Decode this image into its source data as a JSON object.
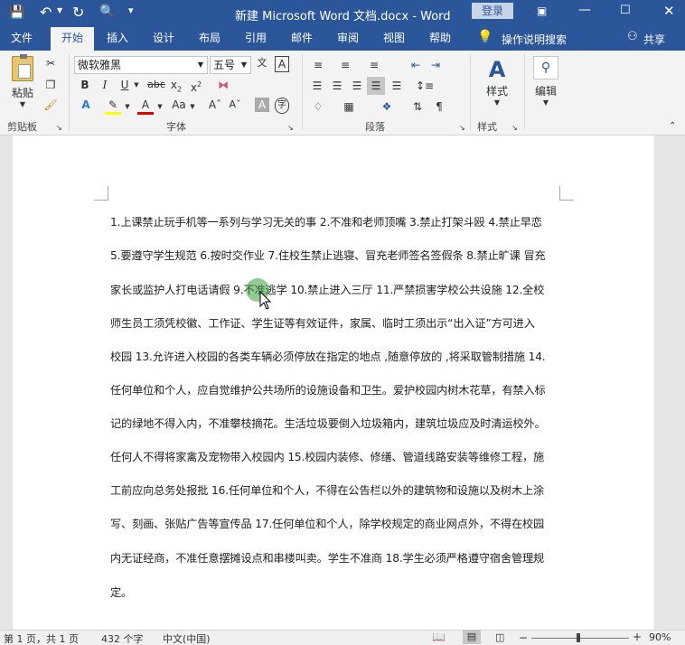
{
  "title_bar": {
    "doc_title": "新建 Microsoft Word 文档.docx  -  Word",
    "login_label": "登录"
  },
  "tabs": [
    "文件",
    "开始",
    "插入",
    "设计",
    "布局",
    "引用",
    "邮件",
    "审阅",
    "视图",
    "帮助"
  ],
  "active_tab": "开始",
  "tell_me": "操作说明搜索",
  "share_label": "共享",
  "ribbon": {
    "paste_label": "粘贴",
    "clipboard_group": "剪贴板",
    "font_name": "微软雅黑",
    "font_size": "五号",
    "font_group": "字体",
    "paragraph_group": "段落",
    "styles_label": "样式",
    "styles_group": "样式",
    "edit_label": "编辑"
  },
  "document": {
    "lines": [
      "1.上课禁止玩手机等一系列与学习无关的事 2.不准和老师顶嘴 3.禁止打架斗殴 4.禁止早恋",
      "5.要遵守学生规范 6.按时交作业 7.住校生禁止逃寝、冒充老师签名签假条 8.禁止旷课  冒充",
      "家长或监护人打电话请假 9.不准逃学 10.禁止进入三厅 11.严禁损害学校公共设施 12.全校",
      "师生员工须凭校徽、工作证、学生证等有效证件，家属、临时工须出示“出入证”方可进入",
      "校园 13.允许进入校园的各类车辆必须停放在指定的地点 ,随意停放的 ,将采取管制措施 14.",
      "任何单位和个人，应自觉维护公共场所的设施设备和卫生。爱护校园内树木花草，有禁入标",
      "记的绿地不得入内，不准攀枝摘花。生活垃圾要倒入垃圾箱内，建筑垃圾应及时清运校外。",
      "任何人不得将家禽及宠物带入校园内 15.校园内装修、修缮、管道线路安装等维修工程，施",
      "工前应向总务处报批 16.任何单位和个人，不得在公告栏以外的建筑物和设施以及树木上涂",
      "写、刻画、张贴广告等宣传品 17.任何单位和个人，除学校规定的商业网点外，不得在校园",
      "内无证经商，不准任意摆摊设点和串楼叫卖。学生不准商 18.学生必须严格遵守宿舍管理规",
      "定。"
    ]
  },
  "status_bar": {
    "page_info": "第 1 页，共 1 页",
    "word_count": "432 个字",
    "language": "中文(中国)",
    "zoom": "90%",
    "zoom_minus": "−",
    "zoom_plus": "+"
  },
  "colors": {
    "accent": "#2b579a",
    "ribbon_bg": "#f3f3f3",
    "highlight": "#ffff00",
    "font_color": "#e00000",
    "cursor_halo": "#3ca03c"
  }
}
